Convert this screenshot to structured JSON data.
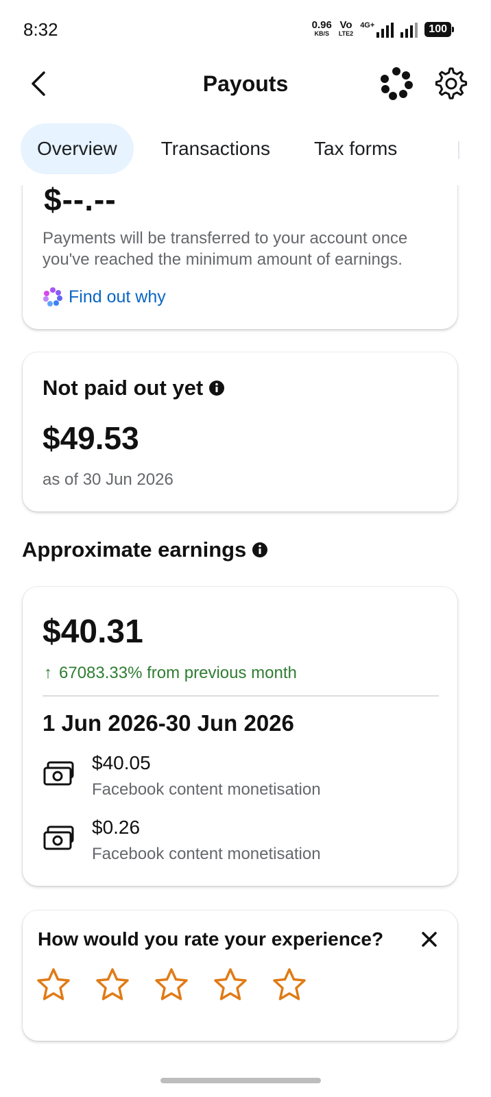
{
  "status_bar": {
    "time": "8:32",
    "net_speed": "0.96",
    "net_unit": "KB/S",
    "volte": "Vo",
    "lte": "LTE2",
    "network": "4G+",
    "battery": "100"
  },
  "header": {
    "title": "Payouts",
    "icons": [
      "back-arrow-icon",
      "meta-ai-icon",
      "gear-icon"
    ]
  },
  "tabs": [
    {
      "label": "Overview",
      "active": true
    },
    {
      "label": "Transactions",
      "active": false
    },
    {
      "label": "Tax forms",
      "active": false
    }
  ],
  "payout_card": {
    "amount": "$--.--",
    "note": "Payments will be transferred to your account once you've reached the minimum amount of earnings.",
    "link": "Find out why"
  },
  "not_paid_card": {
    "title": "Not paid out yet",
    "amount": "$49.53",
    "as_of": "as of 30 Jun 2026"
  },
  "approximate_earnings": {
    "heading": "Approximate earnings",
    "amount": "$40.31",
    "change_arrow": "↑",
    "change_text": "67083.33% from previous month",
    "range": "1 Jun 2026-30 Jun 2026",
    "items": [
      {
        "amount": "$40.05",
        "source": "Facebook content monetisation"
      },
      {
        "amount": "$0.26",
        "source": "Facebook content monetisation"
      }
    ]
  },
  "rating": {
    "question": "How would you rate your experience?",
    "stars": 5,
    "star_color": "#e07b16"
  },
  "colors": {
    "link": "#0a66c2",
    "positive": "#2e7d32",
    "tab_active_bg": "#e7f3ff"
  }
}
